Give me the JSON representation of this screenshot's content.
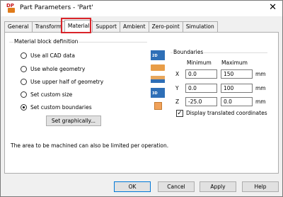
{
  "window": {
    "title": "Part Parameters - 'Part'",
    "close_glyph": "✕",
    "logo_text": "DP"
  },
  "tabs": [
    "General",
    "Transform",
    "Material",
    "Support",
    "Ambient",
    "Zero-point",
    "Simulation"
  ],
  "active_tab": "Material",
  "highlight_color": "#d9242a",
  "material_block": {
    "group_title": "Material block definition",
    "options": [
      {
        "label": "Use all CAD data",
        "selected": false
      },
      {
        "label": "Use whole geometry",
        "selected": false
      },
      {
        "label": "Use upper half of geometry",
        "selected": false
      },
      {
        "label": "Set custom size",
        "selected": false
      },
      {
        "label": "Set custom boundaries",
        "selected": true
      }
    ],
    "set_graphically_button": "Set graphically...",
    "option_icons": [
      "cube-2d-icon",
      "block-icon",
      "half-block-icon",
      "custom-size-icon",
      "custom-boundaries-icon"
    ],
    "icon_labels": {
      "first": "2D",
      "fourth": "3D"
    }
  },
  "boundaries": {
    "group_title": "Boundaries",
    "min_header": "Minimum",
    "max_header": "Maximum",
    "rows": [
      {
        "axis": "X",
        "min": "0.0",
        "max": "150",
        "unit": "mm"
      },
      {
        "axis": "Y",
        "min": "0.0",
        "max": "100",
        "unit": "mm"
      },
      {
        "axis": "Z",
        "min": "-25.0",
        "max": "0.0",
        "unit": "mm"
      }
    ],
    "display_translated": {
      "label": "Display translated coordinates",
      "checked": true,
      "check_glyph": "✓"
    }
  },
  "info_text": "The area to be machined can also be limited per operation.",
  "footer": {
    "ok": "OK",
    "cancel": "Cancel",
    "apply": "Apply",
    "help": "Help"
  }
}
